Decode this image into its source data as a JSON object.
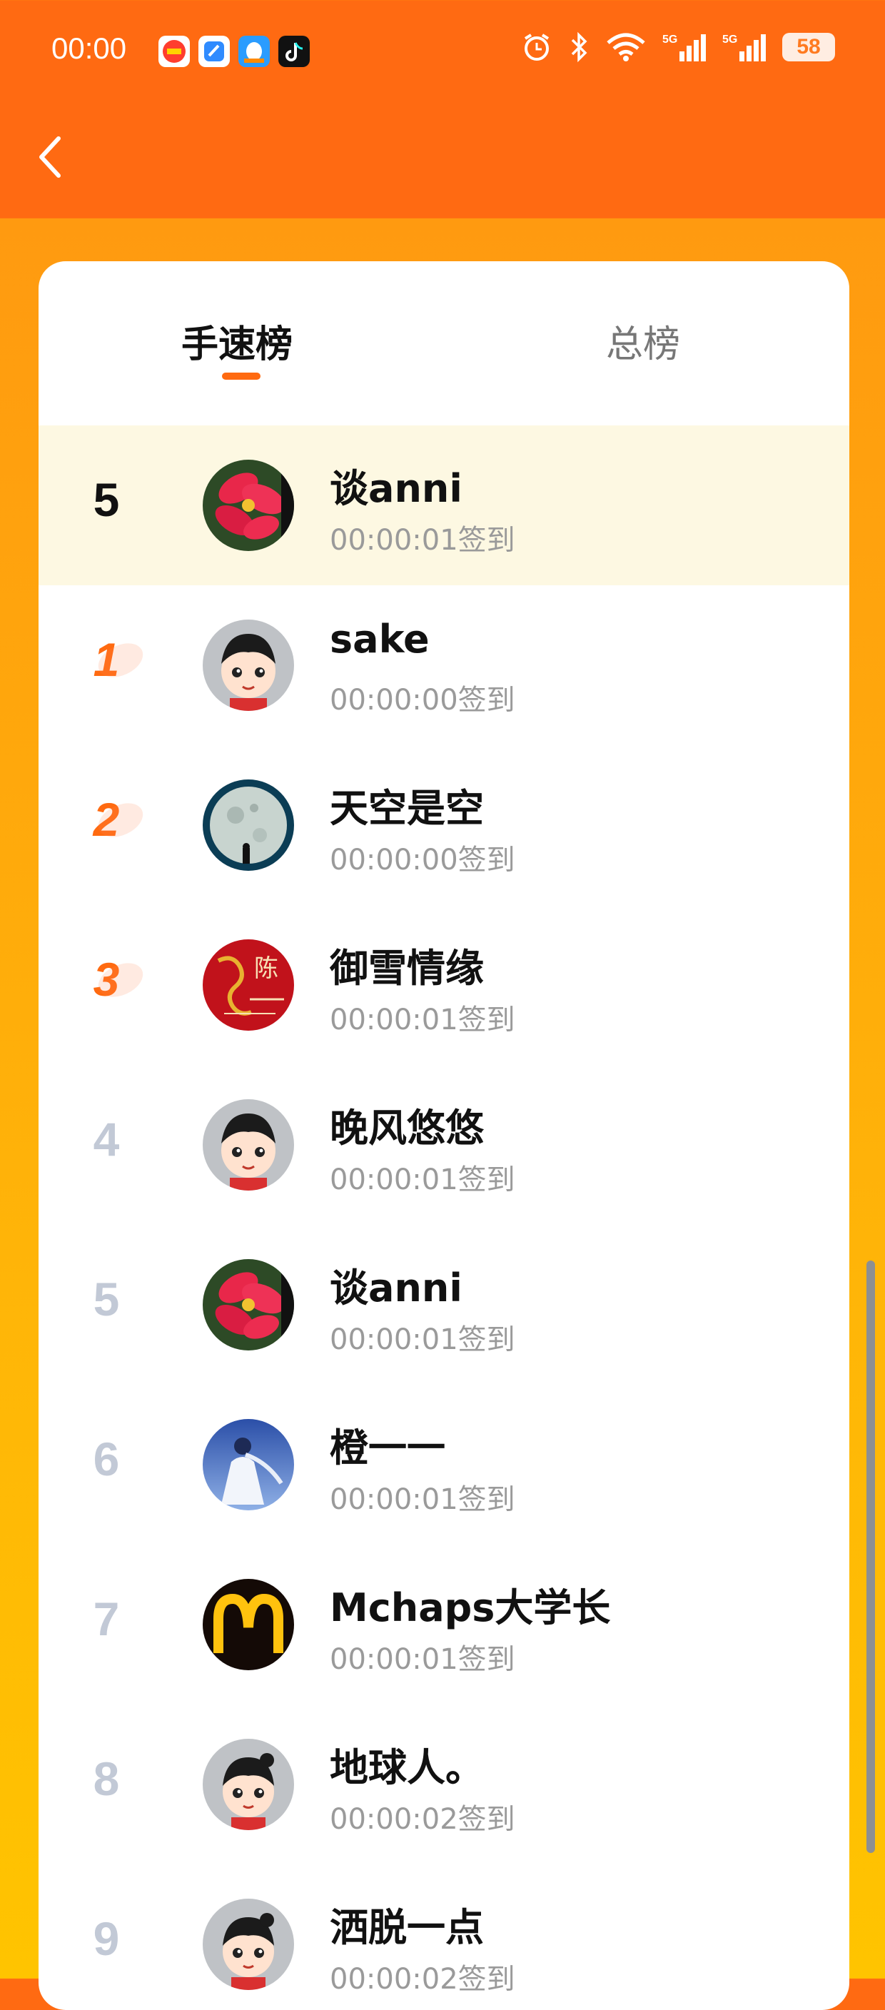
{
  "status_bar": {
    "time": "00:00",
    "battery": "58",
    "app_icons": [
      "red-app-icon",
      "blue-app-icon",
      "qq-app-icon",
      "douyin-app-icon"
    ],
    "system_icons": [
      "alarm-icon",
      "bluetooth-icon",
      "wifi-icon",
      "5g-signal-icon",
      "5g-signal-icon"
    ]
  },
  "header": {
    "back_icon": "chevron-left-icon"
  },
  "tabs": [
    {
      "label": "手速榜",
      "active": true
    },
    {
      "label": "总榜",
      "active": false
    }
  ],
  "colors": {
    "header": "#ff6a12",
    "accent": "#ff6a10",
    "self_row": "#fdf8e2",
    "rank_gray": "#c2c9d6"
  },
  "self_entry": {
    "rank": "5",
    "name": "谈anni",
    "checkin": "00:00:01签到",
    "avatar": "poinsettia-avatar"
  },
  "leaderboard": [
    {
      "rank": "1",
      "name": "sake",
      "checkin": "00:00:00签到",
      "avatar": "cartoon-boy-avatar"
    },
    {
      "rank": "2",
      "name": "天空是空",
      "checkin": "00:00:00签到",
      "avatar": "moon-avatar"
    },
    {
      "rank": "3",
      "name": "御雪情缘",
      "checkin": "00:00:01签到",
      "avatar": "red-dragon-avatar"
    },
    {
      "rank": "4",
      "name": "晚风悠悠",
      "checkin": "00:00:01签到",
      "avatar": "cartoon-boy-avatar"
    },
    {
      "rank": "5",
      "name": "谈anni",
      "checkin": "00:00:01签到",
      "avatar": "poinsettia-avatar"
    },
    {
      "rank": "6",
      "name": "橙一一",
      "checkin": "00:00:01签到",
      "avatar": "girl-in-white-avatar"
    },
    {
      "rank": "7",
      "name": "Mchaps大学长",
      "checkin": "00:00:01签到",
      "avatar": "mcdonalds-logo-avatar"
    },
    {
      "rank": "8",
      "name": "地球人。",
      "checkin": "00:00:02签到",
      "avatar": "cartoon-girl-avatar"
    },
    {
      "rank": "9",
      "name": "洒脱一点",
      "checkin": "00:00:02签到",
      "avatar": "cartoon-girl-avatar"
    }
  ]
}
